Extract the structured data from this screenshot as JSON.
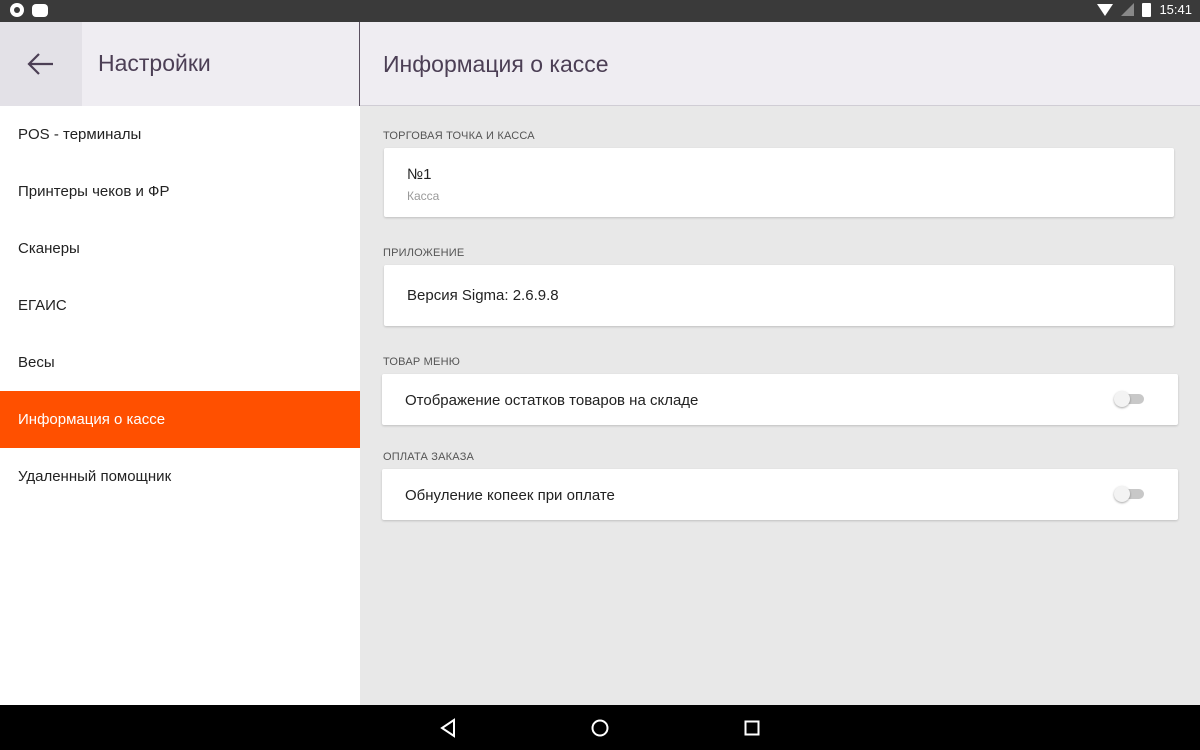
{
  "status_bar": {
    "time": "15:41",
    "icons": [
      "app-notification-icon",
      "chat-notification-icon",
      "wifi-icon",
      "no-signal-icon",
      "battery-charging-icon"
    ]
  },
  "header": {
    "back_icon": "arrow-left-icon",
    "left_title": "Настройки",
    "right_title": "Информация о кассе"
  },
  "sidebar": {
    "items": [
      {
        "label": "POS - терминалы",
        "active": false
      },
      {
        "label": "Принтеры чеков и ФР",
        "active": false
      },
      {
        "label": "Сканеры",
        "active": false
      },
      {
        "label": "ЕГАИС",
        "active": false
      },
      {
        "label": "Весы",
        "active": false
      },
      {
        "label": "Информация о кассе",
        "active": true
      },
      {
        "label": "Удаленный помощник",
        "active": false
      }
    ]
  },
  "content": {
    "sections": [
      {
        "label": "ТОРГОВАЯ ТОЧКА И КАССА",
        "title": "№1",
        "subtitle": "Касса"
      },
      {
        "label": "ПРИЛОЖЕНИЕ",
        "title": "Версия Sigma: 2.6.9.8"
      },
      {
        "label": "ТОВАР МЕНЮ",
        "title": "Отображение остатков товаров на складе",
        "toggle_on": false
      },
      {
        "label": "ОПЛАТА ЗАКАЗА",
        "title": "Обнуление копеек при оплате",
        "toggle_on": false
      }
    ]
  },
  "nav_bar": {
    "icons": [
      "back-triangle-icon",
      "home-circle-icon",
      "recents-square-icon"
    ]
  },
  "colors": {
    "accent": "#ff5000",
    "header_bg": "#efedf2",
    "title_text": "#4c3f55",
    "content_bg": "#e8e8e8"
  }
}
